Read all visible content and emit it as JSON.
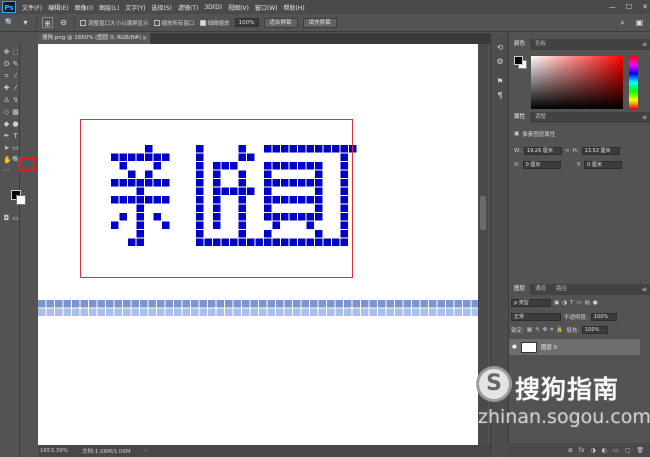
{
  "app": {
    "logo_text": "Ps",
    "menus": [
      "文件(F)",
      "编辑(E)",
      "图像(I)",
      "图层(L)",
      "文字(Y)",
      "选择(S)",
      "滤镜(T)",
      "3D(D)",
      "视图(V)",
      "窗口(W)",
      "帮助(H)"
    ],
    "window_controls": [
      "—",
      "☐",
      "✕"
    ]
  },
  "options": {
    "resize_windows_label": "调整窗口大小以满屏显示",
    "zoom_all_label": "缩放所有窗口",
    "scrubby_zoom_label": "细微缩放",
    "zoom_value": "100%",
    "fit_screen_button": "适合屏幕",
    "fill_screen_button": "填充屏幕",
    "resize_windows_checked": false,
    "zoom_all_checked": false,
    "scrubby_zoom_checked": true
  },
  "document": {
    "tab_title": "搜狗.png @ 1650% (图层 0, RGB/8#)",
    "tab_close": "×",
    "status_zoom": "1653.39%",
    "status_doc": "文档:1.06M/1.06M",
    "pixel_color": "#0000c8",
    "highlight_color": "#e0303a"
  },
  "panels": {
    "color_tabs": [
      "颜色",
      "色板"
    ],
    "properties_tabs": [
      "属性",
      "调整"
    ],
    "properties_title": "像素图层属性",
    "width_label": "W:",
    "width_value": "19.26 厘米",
    "height_label": "H:",
    "height_value": "13.52 厘米",
    "x_label": "X:",
    "x_value": "0 厘米",
    "y_label": "Y:",
    "y_value": "0 厘米",
    "link_icon": "∞",
    "layers_tabs": [
      "图层",
      "通道",
      "路径"
    ],
    "filter_label": "ρ 类型",
    "blend_mode": "正常",
    "opacity_label": "不透明度:",
    "opacity_value": "100%",
    "lock_label": "锁定:",
    "fill_label": "填充:",
    "fill_value": "100%",
    "layer_name": "图层 0",
    "layer_visibility": "●",
    "footer_icons": [
      "⊕",
      "fx",
      "◑",
      "◐",
      "▭",
      "▢",
      "🗑"
    ],
    "menu_icon": "≡"
  },
  "watermark": {
    "logo_glyph": "S",
    "brand": "搜狗指南",
    "url": "zhinan.sogou.com"
  }
}
